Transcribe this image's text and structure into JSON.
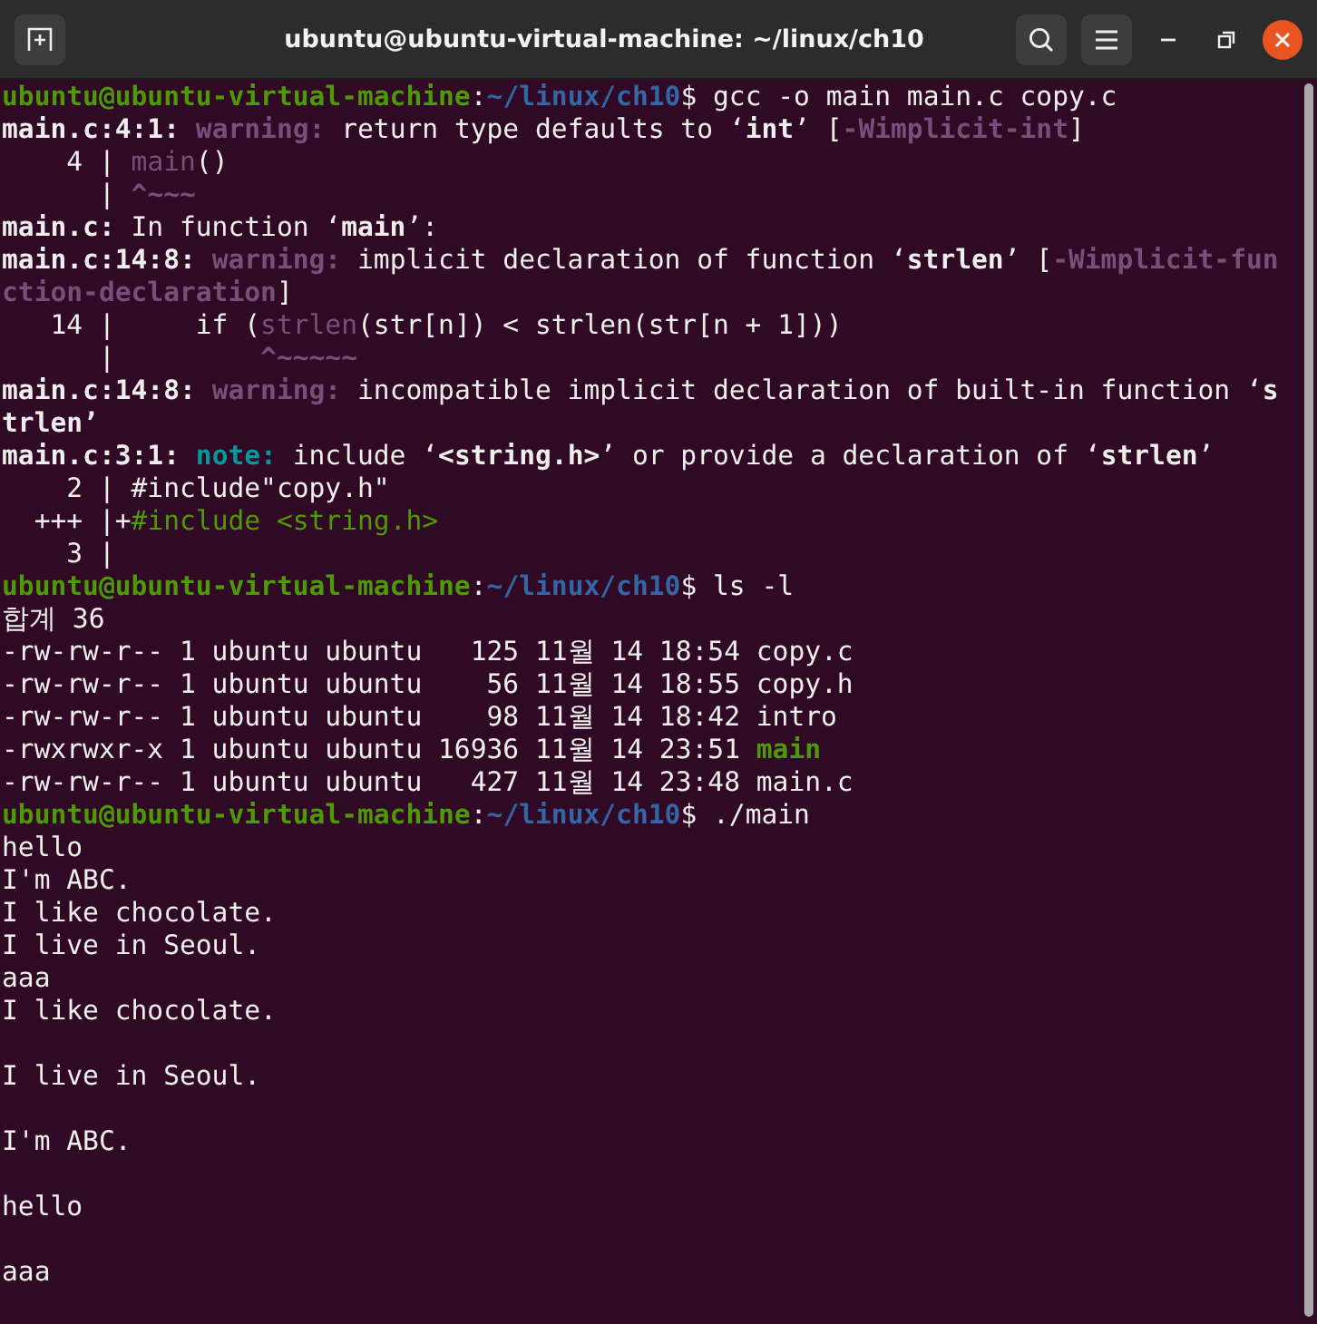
{
  "window": {
    "title": "ubuntu@ubuntu-virtual-machine: ~/linux/ch10"
  },
  "lines": [
    {
      "kind": "text",
      "segments": [
        {
          "kind": "user",
          "text": "ubuntu@ubuntu-virtual-machine"
        },
        {
          "kind": "plain",
          "text": ":"
        },
        {
          "kind": "path",
          "text": "~/linux/ch10"
        },
        {
          "kind": "plain",
          "text": "$ gcc -o main main.c copy.c"
        }
      ]
    },
    {
      "kind": "text",
      "segments": [
        {
          "kind": "bold",
          "text": "main.c:4:1: "
        },
        {
          "kind": "warning",
          "text": "warning:"
        },
        {
          "kind": "plain",
          "text": " return type defaults to ‘"
        },
        {
          "kind": "bold",
          "text": "int"
        },
        {
          "kind": "plain",
          "text": "’ ["
        },
        {
          "kind": "warning",
          "text": "-Wimplicit-int"
        },
        {
          "kind": "plain",
          "text": "]"
        }
      ]
    },
    {
      "kind": "text",
      "segments": [
        {
          "kind": "plain",
          "text": "    4 | "
        },
        {
          "kind": "hint",
          "text": "main"
        },
        {
          "kind": "plain",
          "text": "()"
        }
      ]
    },
    {
      "kind": "text",
      "segments": [
        {
          "kind": "plain",
          "text": "      | "
        },
        {
          "kind": "warning",
          "text": "^~~~"
        }
      ]
    },
    {
      "kind": "text",
      "segments": [
        {
          "kind": "bold",
          "text": "main.c:"
        },
        {
          "kind": "plain",
          "text": " In function ‘"
        },
        {
          "kind": "bold",
          "text": "main"
        },
        {
          "kind": "plain",
          "text": "’:"
        }
      ]
    },
    {
      "kind": "text",
      "segments": [
        {
          "kind": "bold",
          "text": "main.c:14:8: "
        },
        {
          "kind": "warning",
          "text": "warning:"
        },
        {
          "kind": "plain",
          "text": " implicit declaration of function ‘"
        },
        {
          "kind": "bold",
          "text": "strlen"
        },
        {
          "kind": "plain",
          "text": "’ ["
        },
        {
          "kind": "warning",
          "text": "-Wimplicit-fun"
        }
      ]
    },
    {
      "kind": "text",
      "segments": [
        {
          "kind": "warning",
          "text": "ction-declaration"
        },
        {
          "kind": "plain",
          "text": "]"
        }
      ]
    },
    {
      "kind": "text",
      "segments": [
        {
          "kind": "plain",
          "text": "   14 |     if ("
        },
        {
          "kind": "hint",
          "text": "strlen"
        },
        {
          "kind": "plain",
          "text": "(str[n]) < strlen(str[n + 1]))"
        }
      ]
    },
    {
      "kind": "text",
      "segments": [
        {
          "kind": "plain",
          "text": "      |         "
        },
        {
          "kind": "warning",
          "text": "^~~~~~"
        }
      ]
    },
    {
      "kind": "text",
      "segments": [
        {
          "kind": "bold",
          "text": "main.c:14:8: "
        },
        {
          "kind": "warning",
          "text": "warning:"
        },
        {
          "kind": "plain",
          "text": " incompatible implicit declaration of built-in function ‘"
        },
        {
          "kind": "bold",
          "text": "s"
        }
      ]
    },
    {
      "kind": "text",
      "segments": [
        {
          "kind": "bold",
          "text": "trlen’"
        }
      ]
    },
    {
      "kind": "text",
      "segments": [
        {
          "kind": "bold",
          "text": "main.c:3:1: "
        },
        {
          "kind": "note",
          "text": "note:"
        },
        {
          "kind": "plain",
          "text": " include ‘"
        },
        {
          "kind": "bold",
          "text": "<string.h>"
        },
        {
          "kind": "plain",
          "text": "’ or provide a declaration of ‘"
        },
        {
          "kind": "bold",
          "text": "strlen"
        },
        {
          "kind": "plain",
          "text": "’"
        }
      ]
    },
    {
      "kind": "text",
      "segments": [
        {
          "kind": "plain",
          "text": "    2 | #include\"copy.h\""
        }
      ]
    },
    {
      "kind": "text",
      "segments": [
        {
          "kind": "plain",
          "text": "  +++ |+"
        },
        {
          "kind": "fixit",
          "text": "#include <string.h>"
        }
      ]
    },
    {
      "kind": "text",
      "segments": [
        {
          "kind": "plain",
          "text": "    3 |"
        }
      ]
    },
    {
      "kind": "text",
      "segments": [
        {
          "kind": "user",
          "text": "ubuntu@ubuntu-virtual-machine"
        },
        {
          "kind": "plain",
          "text": ":"
        },
        {
          "kind": "path",
          "text": "~/linux/ch10"
        },
        {
          "kind": "plain",
          "text": "$ ls -l"
        }
      ]
    },
    {
      "kind": "text",
      "segments": [
        {
          "kind": "plain",
          "text": "합계 36"
        }
      ]
    },
    {
      "kind": "text",
      "segments": [
        {
          "kind": "plain",
          "text": "-rw-rw-r-- 1 ubuntu ubuntu   125 11월 14 18:54 copy.c"
        }
      ]
    },
    {
      "kind": "text",
      "segments": [
        {
          "kind": "plain",
          "text": "-rw-rw-r-- 1 ubuntu ubuntu    56 11월 14 18:55 copy.h"
        }
      ]
    },
    {
      "kind": "text",
      "segments": [
        {
          "kind": "plain",
          "text": "-rw-rw-r-- 1 ubuntu ubuntu    98 11월 14 18:42 intro"
        }
      ]
    },
    {
      "kind": "text",
      "segments": [
        {
          "kind": "plain",
          "text": "-rwxrwxr-x 1 ubuntu ubuntu 16936 11월 14 23:51 "
        },
        {
          "kind": "exec",
          "text": "main"
        }
      ]
    },
    {
      "kind": "text",
      "segments": [
        {
          "kind": "plain",
          "text": "-rw-rw-r-- 1 ubuntu ubuntu   427 11월 14 23:48 main.c"
        }
      ]
    },
    {
      "kind": "text",
      "segments": [
        {
          "kind": "user",
          "text": "ubuntu@ubuntu-virtual-machine"
        },
        {
          "kind": "plain",
          "text": ":"
        },
        {
          "kind": "path",
          "text": "~/linux/ch10"
        },
        {
          "kind": "plain",
          "text": "$ ./main"
        }
      ]
    },
    {
      "kind": "text",
      "segments": [
        {
          "kind": "plain",
          "text": "hello"
        }
      ]
    },
    {
      "kind": "text",
      "segments": [
        {
          "kind": "plain",
          "text": "I'm ABC."
        }
      ]
    },
    {
      "kind": "text",
      "segments": [
        {
          "kind": "plain",
          "text": "I like chocolate."
        }
      ]
    },
    {
      "kind": "text",
      "segments": [
        {
          "kind": "plain",
          "text": "I live in Seoul."
        }
      ]
    },
    {
      "kind": "text",
      "segments": [
        {
          "kind": "plain",
          "text": "aaa"
        }
      ]
    },
    {
      "kind": "text",
      "segments": [
        {
          "kind": "plain",
          "text": "I like chocolate."
        }
      ]
    },
    {
      "kind": "blank"
    },
    {
      "kind": "text",
      "segments": [
        {
          "kind": "plain",
          "text": "I live in Seoul."
        }
      ]
    },
    {
      "kind": "blank"
    },
    {
      "kind": "text",
      "segments": [
        {
          "kind": "plain",
          "text": "I'm ABC."
        }
      ]
    },
    {
      "kind": "blank"
    },
    {
      "kind": "text",
      "segments": [
        {
          "kind": "plain",
          "text": "hello"
        }
      ]
    },
    {
      "kind": "blank"
    },
    {
      "kind": "text",
      "segments": [
        {
          "kind": "plain",
          "text": "aaa"
        }
      ]
    }
  ]
}
